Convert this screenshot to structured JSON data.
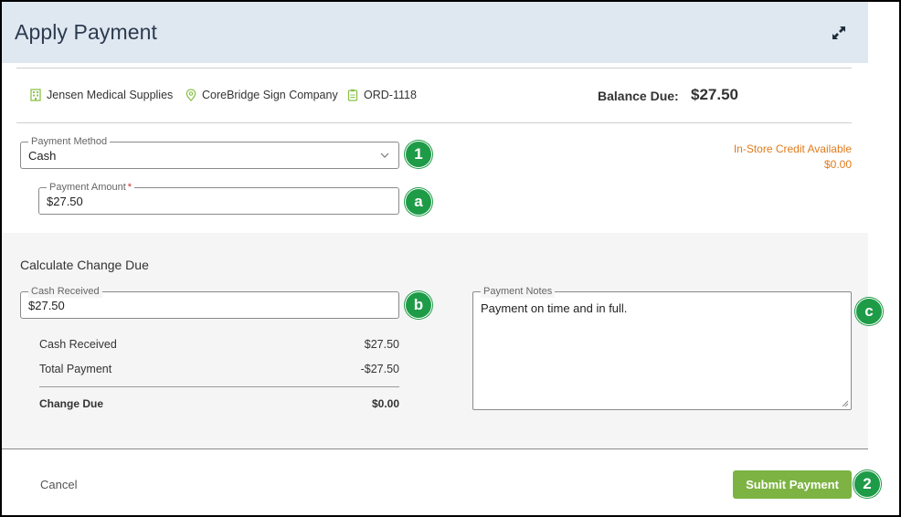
{
  "dialog": {
    "title": "Apply Payment"
  },
  "info_bar": {
    "company": "Jensen Medical Supplies",
    "location": "CoreBridge Sign Company",
    "order": "ORD-1118",
    "balance_label": "Balance Due:",
    "balance_value": "$27.50"
  },
  "payment_method": {
    "label": "Payment Method",
    "value": "Cash"
  },
  "payment_amount": {
    "label": "Payment Amount",
    "required_mark": "*",
    "value": "$27.50"
  },
  "store_credit": {
    "label": "In-Store Credit Available",
    "value": "$0.00"
  },
  "calculate": {
    "title": "Calculate Change Due",
    "cash_received_label": "Cash Received",
    "cash_received_value": "$27.50",
    "summary": [
      {
        "label": "Cash Received",
        "value": "$27.50"
      },
      {
        "label": "Total Payment",
        "value": "-$27.50"
      },
      {
        "label": "Change Due",
        "value": "$0.00"
      }
    ]
  },
  "notes": {
    "label": "Payment Notes",
    "value": "Payment on time and in full."
  },
  "footer": {
    "cancel_label": "Cancel",
    "submit_label": "Submit Payment"
  },
  "markers": {
    "m1": "1",
    "ma": "a",
    "mb": "b",
    "mc": "c",
    "m2": "2"
  },
  "colors": {
    "header_bg": "#dfe7f1",
    "accent_green": "#7cb342",
    "icon_green": "#8bc34a",
    "credit_orange": "#e07b1a",
    "marker_green": "#1e9b47"
  }
}
